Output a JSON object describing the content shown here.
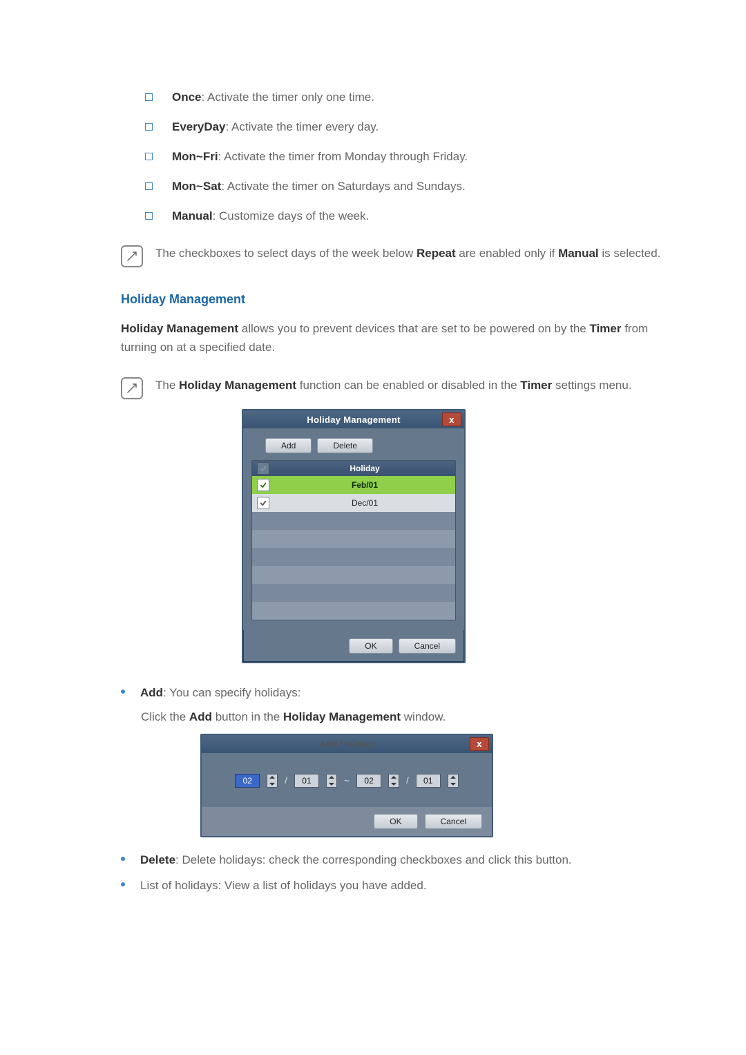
{
  "bullets": [
    {
      "label": "Once",
      "desc": ": Activate the timer only one time."
    },
    {
      "label": "EveryDay",
      "desc": ": Activate the timer every day."
    },
    {
      "label": "Mon~Fri",
      "desc": ": Activate the timer from Monday through Friday."
    },
    {
      "label": "Mon~Sat",
      "desc": ": Activate the timer on Saturdays and Sundays."
    },
    {
      "label": "Manual",
      "desc": ": Customize days of the week."
    }
  ],
  "note1": {
    "pre": "The checkboxes to select days of the week below ",
    "b1": "Repeat",
    "mid": " are enabled only if ",
    "b2": "Manual",
    "post": " is selected."
  },
  "section_title": "Holiday Management",
  "intro": {
    "b1": "Holiday Management",
    "mid": " allows you to prevent devices that are set to be powered on by the ",
    "b2": "Timer",
    "post": " from turning on at a specified date."
  },
  "note2": {
    "pre": "The ",
    "b1": "Holiday Management",
    "mid": " function can be enabled or disabled in the ",
    "b2": "Timer",
    "post": " settings menu."
  },
  "dlg": {
    "title": "Holiday Management",
    "close": "x",
    "add": "Add",
    "delete": "Delete",
    "col_holiday": "Holiday",
    "rows": [
      {
        "checked": true,
        "text": "Feb/01",
        "sel": true
      },
      {
        "checked": true,
        "text": "Dec/01",
        "sel": false
      }
    ],
    "ok": "OK",
    "cancel": "Cancel"
  },
  "add_bullet": {
    "label": "Add",
    "desc": ": You can specify holidays:"
  },
  "add_sub": {
    "pre": "Click the ",
    "b1": "Add",
    "mid": " button in the ",
    "b2": "Holiday Management",
    "post": " window."
  },
  "dlg2": {
    "title": "Add Holiday",
    "close": "x",
    "m1": "02",
    "d1": "01",
    "m2": "02",
    "d2": "01",
    "ok": "OK",
    "cancel": "Cancel"
  },
  "delete_bullet": {
    "label": "Delete",
    "desc": ": Delete holidays: check the corresponding checkboxes and click this button."
  },
  "list_bullet": "List of holidays: View a list of holidays you have added."
}
